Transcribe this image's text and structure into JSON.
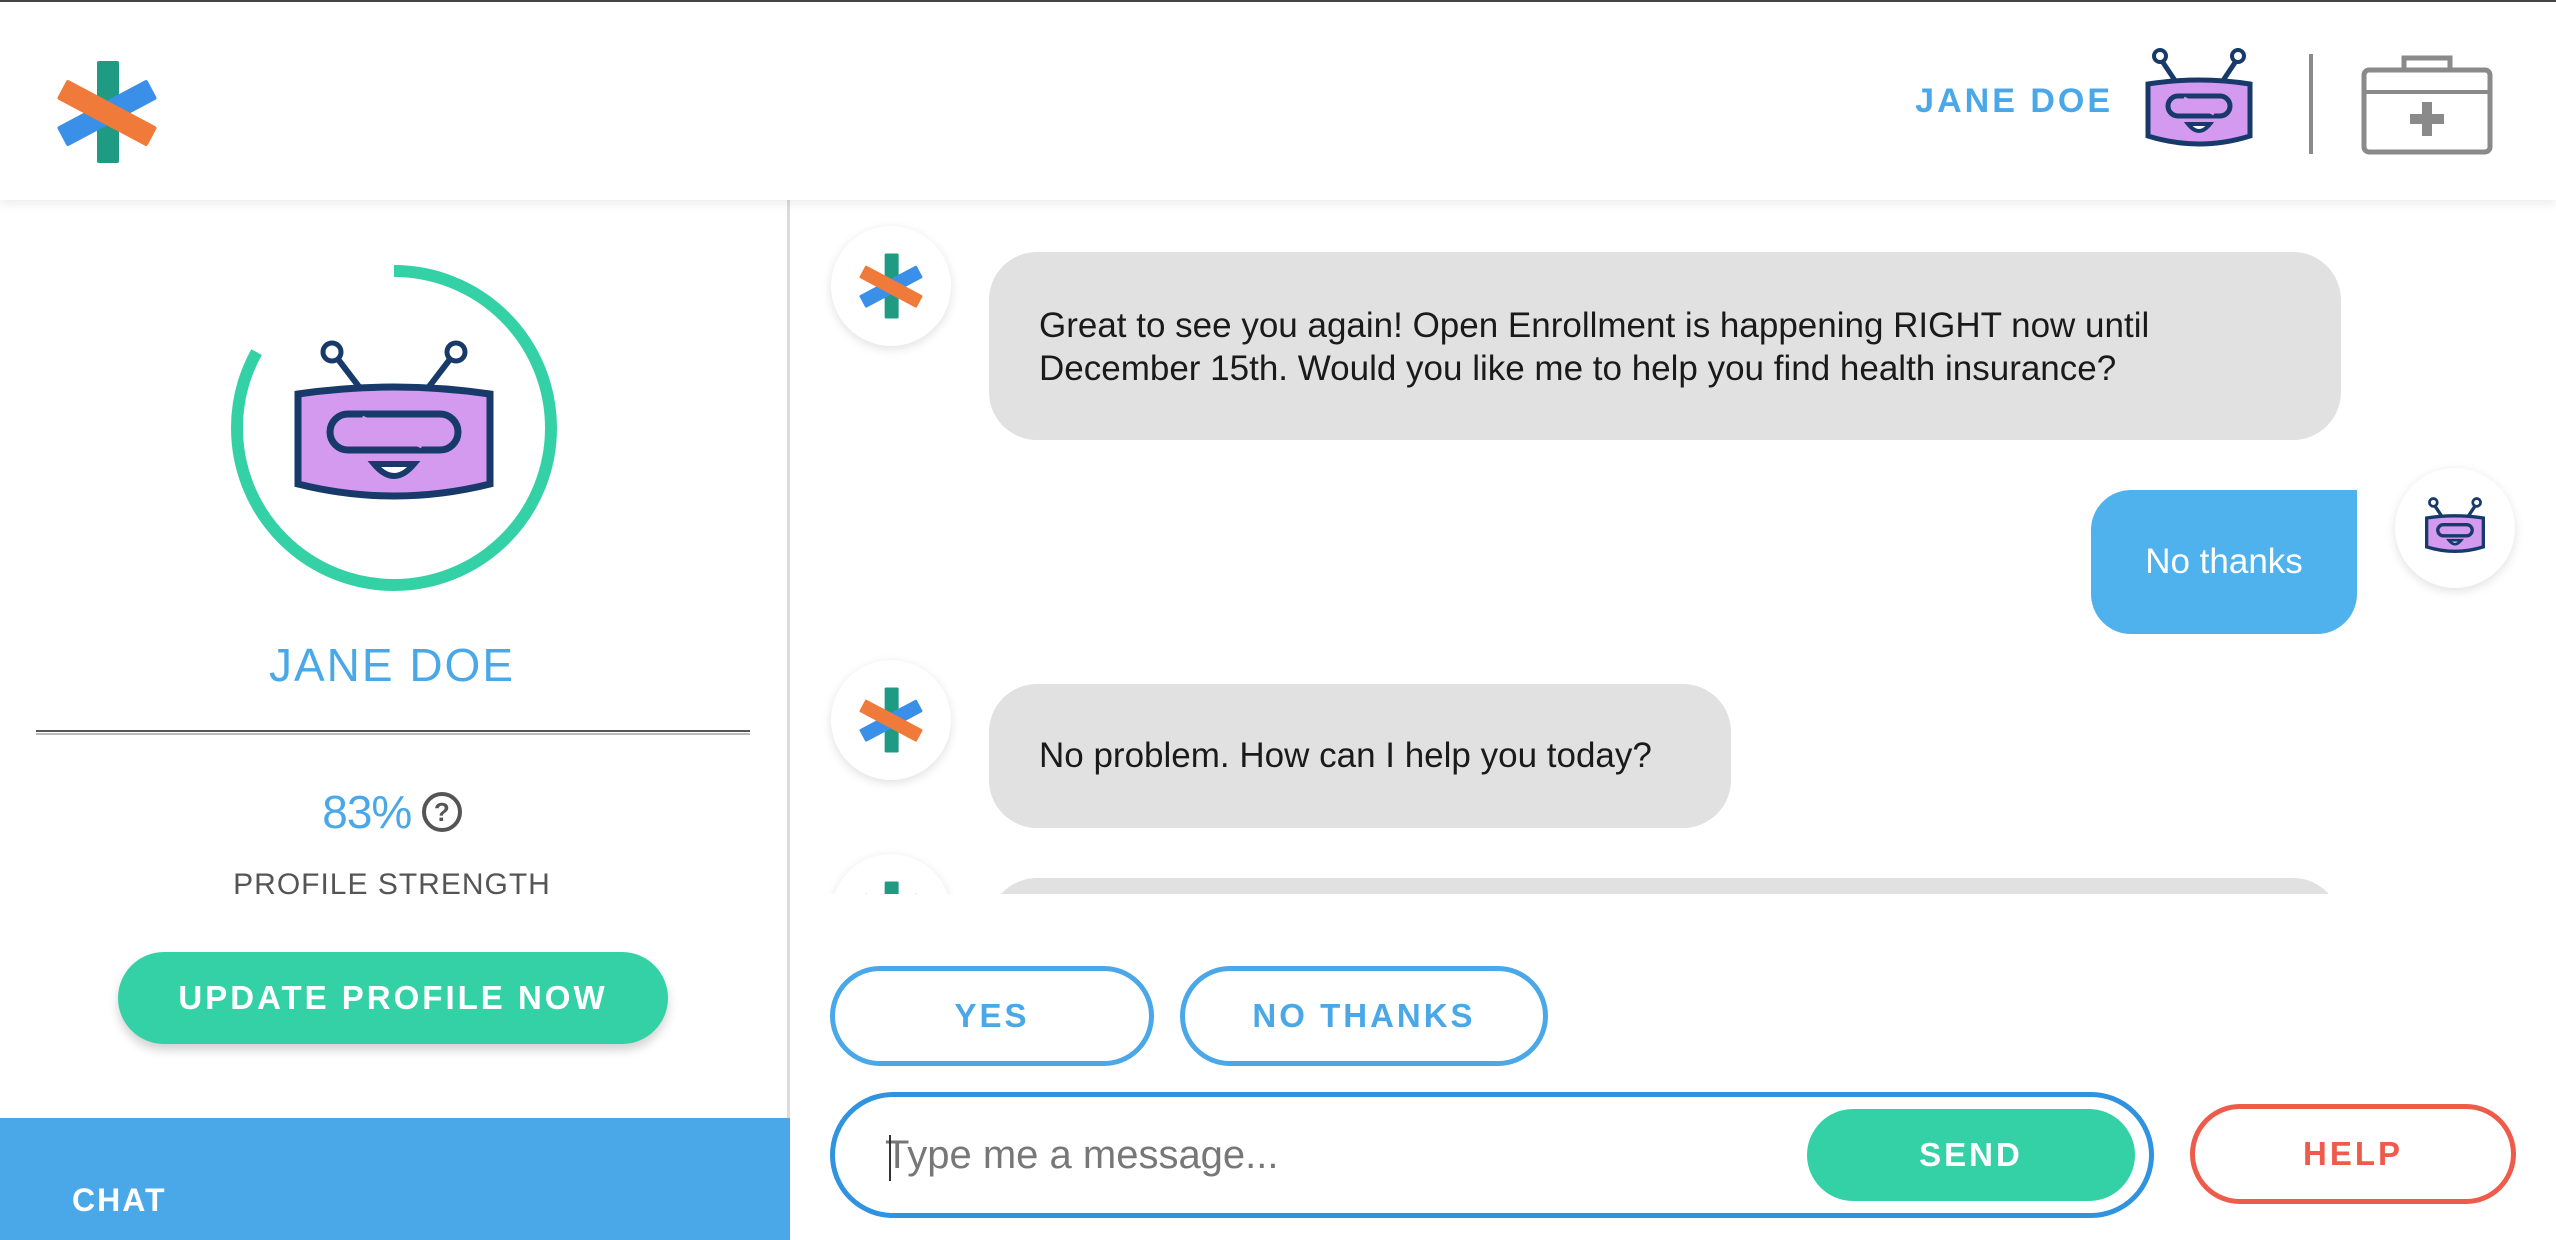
{
  "header": {
    "logo_icon": "asterisk-logo-icon",
    "username": "JANE DOE",
    "avatar_icon": "robot-avatar-icon",
    "kit_icon": "medical-kit-icon"
  },
  "sidebar": {
    "username": "JANE DOE",
    "profile_strength_value": "83%",
    "profile_strength_fraction": 0.83,
    "help_icon_text": "?",
    "profile_strength_label": "PROFILE STRENGTH",
    "update_button_label": "UPDATE PROFILE NOW",
    "chat_tab_label": "CHAT"
  },
  "chat": {
    "messages": [
      {
        "sender": "bot",
        "text": "Great to see you again! Open Enrollment is happening RIGHT now until December 15th. Would you like me to help you find health insurance?"
      },
      {
        "sender": "user",
        "text": "No thanks"
      },
      {
        "sender": "bot",
        "text": "No problem. How can I help you today?"
      }
    ]
  },
  "quick_replies": {
    "yes_label": "YES",
    "no_thanks_label": "NO THANKS"
  },
  "composer": {
    "placeholder": "Type me a message...",
    "send_label": "SEND",
    "help_label": "HELP"
  },
  "colors": {
    "accent_blue": "#4aa8e8",
    "accent_green": "#35d1a6",
    "help_red": "#ef5b4b",
    "robot_purple": "#d49af0",
    "robot_navy": "#173a6b"
  }
}
